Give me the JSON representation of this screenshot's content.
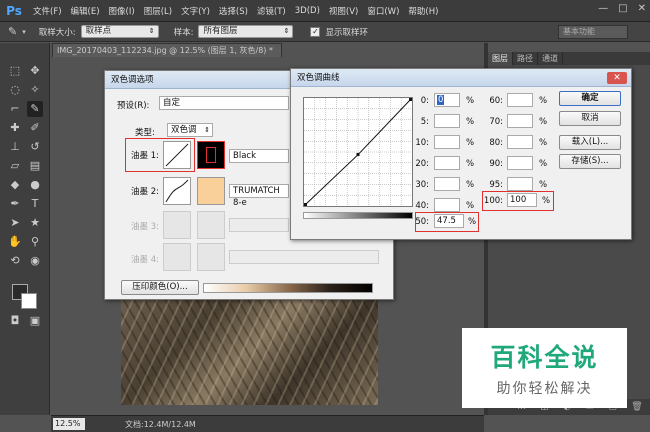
{
  "app": {
    "logo": "Ps",
    "menu": [
      "文件(F)",
      "编辑(E)",
      "图像(I)",
      "图层(L)",
      "文字(Y)",
      "选择(S)",
      "滤镜(T)",
      "3D(D)",
      "视图(V)",
      "窗口(W)",
      "帮助(H)"
    ],
    "window_controls": [
      "—",
      "□",
      "✕"
    ]
  },
  "options_bar": {
    "sample_size_label": "取样大小:",
    "sample_size_value": "取样点",
    "sample_label": "样本:",
    "sample_value": "所有图层",
    "show_ring_label": "显示取样环",
    "workspace": "基本功能"
  },
  "document": {
    "tab_title": "IMG_20170403_112234.jpg @ 12.5% (图层 1, 灰色/8) *",
    "zoom": "12.5%",
    "info": "文档:12.4M/12.4M"
  },
  "panels": {
    "tabs": [
      "图层",
      "路径",
      "通道"
    ]
  },
  "duotone_dialog": {
    "title": "双色调选项",
    "preset_label": "预设(R):",
    "preset_value": "自定",
    "type_label": "类型:",
    "type_value": "双色调",
    "inks": [
      {
        "label": "油墨 1:",
        "name": "Black"
      },
      {
        "label": "油墨 2:",
        "name": "TRUMATCH 8-e"
      },
      {
        "label": "油墨 3:",
        "name": ""
      },
      {
        "label": "油墨 4:",
        "name": ""
      }
    ],
    "overprint_button": "压印颜色(O)...",
    "ink2_color": "#f9cf9a"
  },
  "curve_dialog": {
    "title": "双色调曲线",
    "left_col": [
      {
        "label": "0:",
        "value": "0"
      },
      {
        "label": "5:",
        "value": ""
      },
      {
        "label": "10:",
        "value": ""
      },
      {
        "label": "20:",
        "value": ""
      },
      {
        "label": "30:",
        "value": ""
      },
      {
        "label": "40:",
        "value": ""
      },
      {
        "label": "50:",
        "value": "47.5"
      }
    ],
    "right_col": [
      {
        "label": "60:",
        "value": ""
      },
      {
        "label": "70:",
        "value": ""
      },
      {
        "label": "80:",
        "value": ""
      },
      {
        "label": "90:",
        "value": ""
      },
      {
        "label": "95:",
        "value": ""
      },
      {
        "label": "100:",
        "value": "100"
      }
    ],
    "unit": "%",
    "buttons": [
      "确定",
      "取消",
      "载入(L)...",
      "存储(S)..."
    ]
  },
  "watermark": {
    "title": "百科全说",
    "subtitle": "助你轻松解决"
  }
}
